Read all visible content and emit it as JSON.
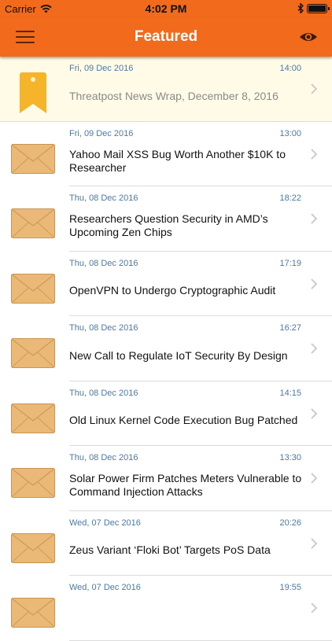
{
  "status_bar": {
    "carrier": "Carrier",
    "time": "4:02 PM"
  },
  "navbar": {
    "title": "Featured",
    "left_icon": "hamburger-menu-icon",
    "right_icon": "eye-icon"
  },
  "colors": {
    "accent": "#f26a1b",
    "date_text": "#4a7aa8",
    "featured_bg": "#fffbe6",
    "envelope": "#eab877",
    "ribbon": "#f6b42a"
  },
  "articles": [
    {
      "date": "Fri, 09 Dec 2016",
      "time": "14:00",
      "title": "Threatpost News Wrap, December 8, 2016",
      "icon": "bookmark-ribbon-icon",
      "featured": true
    },
    {
      "date": "Fri, 09 Dec 2016",
      "time": "13:00",
      "title": "Yahoo Mail XSS Bug Worth Another $10K to Researcher",
      "icon": "envelope-icon",
      "featured": false
    },
    {
      "date": "Thu, 08 Dec 2016",
      "time": "18:22",
      "title": "Researchers Question Security in AMD’s Upcoming Zen Chips",
      "icon": "envelope-icon",
      "featured": false
    },
    {
      "date": "Thu, 08 Dec 2016",
      "time": "17:19",
      "title": "OpenVPN to Undergo Cryptographic Audit",
      "icon": "envelope-icon",
      "featured": false
    },
    {
      "date": "Thu, 08 Dec 2016",
      "time": "16:27",
      "title": "New Call to Regulate IoT Security By Design",
      "icon": "envelope-icon",
      "featured": false
    },
    {
      "date": "Thu, 08 Dec 2016",
      "time": "14:15",
      "title": "Old Linux Kernel Code Execution Bug Patched",
      "icon": "envelope-icon",
      "featured": false
    },
    {
      "date": "Thu, 08 Dec 2016",
      "time": "13:30",
      "title": "Solar Power Firm Patches Meters Vulnerable to Command Injection Attacks",
      "icon": "envelope-icon",
      "featured": false
    },
    {
      "date": "Wed, 07 Dec 2016",
      "time": "20:26",
      "title": "Zeus Variant ‘Floki Bot’ Targets PoS Data",
      "icon": "envelope-icon",
      "featured": false
    },
    {
      "date": "Wed, 07 Dec 2016",
      "time": "19:55",
      "title": "",
      "icon": "envelope-icon",
      "featured": false
    }
  ]
}
